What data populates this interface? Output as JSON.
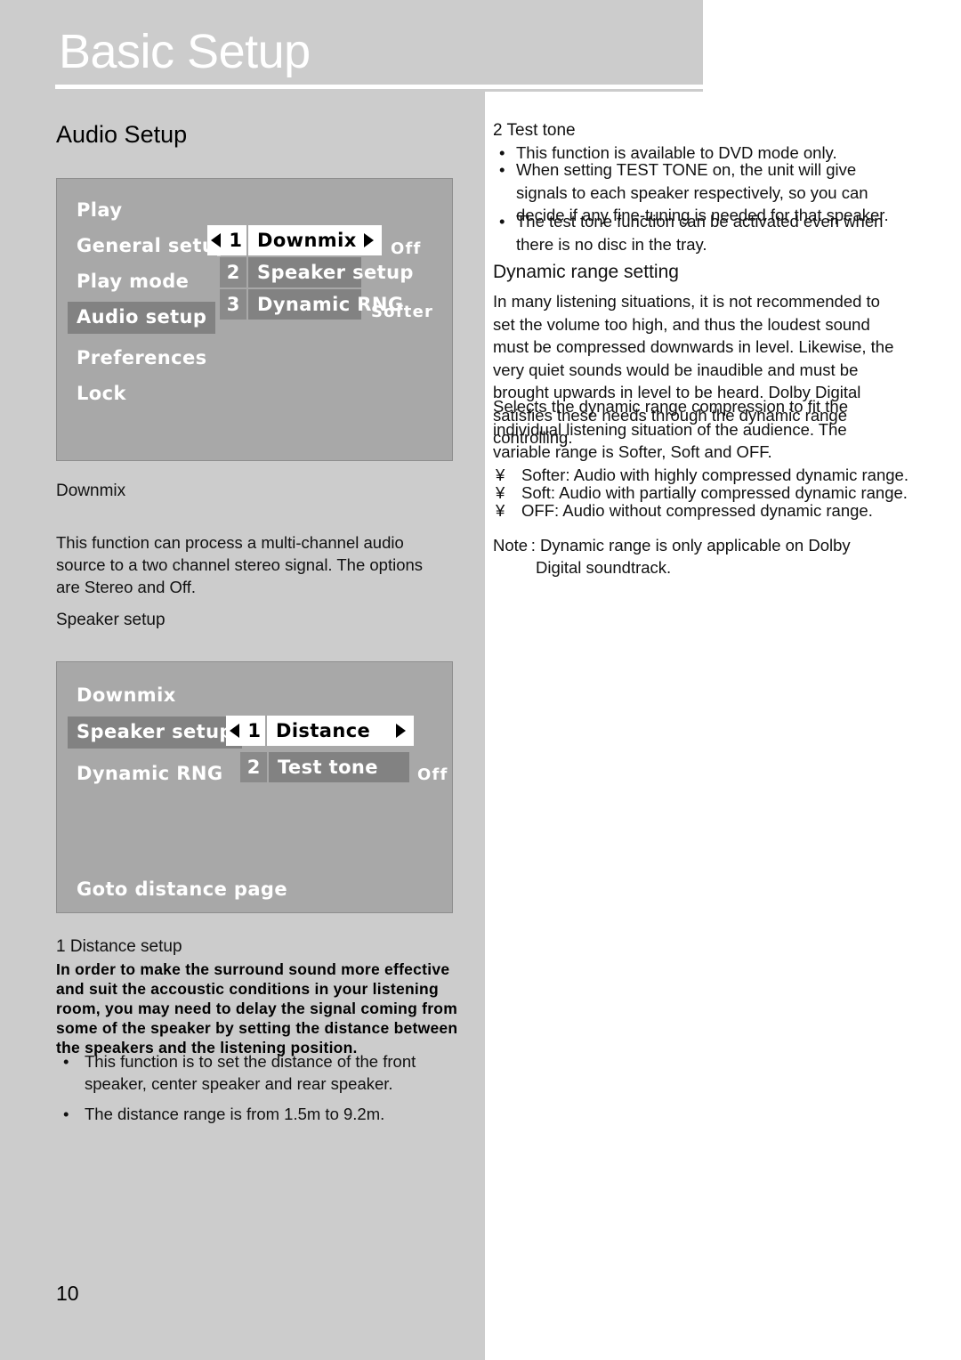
{
  "header": {
    "title": "Basic Setup"
  },
  "left": {
    "section_heading": "Audio Setup",
    "labels": {
      "downmix": "Downmix",
      "speaker_setup": "Speaker setup",
      "distance_setup": "1 Distance setup"
    },
    "downmix_paragraph": "This function can process a multi-channel audio source to a two channel stereo signal. The options are Stereo and Off.",
    "distance_bold_paragraph": "In order to make the surround sound more effective and suit the accoustic conditions in your listening room, you may need to delay the signal coming from some of the speaker by setting the distance between the speakers and the listening position.",
    "bullets": [
      {
        "dot": "•",
        "text": "This function is  to set the distance of the front speaker, center speaker and rear speaker."
      },
      {
        "dot": "•",
        "text": "The distance range is from 1.5m  to 9.2m."
      }
    ],
    "page_number": "10"
  },
  "osd_menu_1": {
    "left_items": [
      {
        "label": "Play",
        "selected": false
      },
      {
        "label": "General setup",
        "selected": false
      },
      {
        "label": "Play mode",
        "selected": false
      },
      {
        "label": "Audio setup",
        "selected": true
      },
      {
        "label": "Preferences",
        "selected": false
      },
      {
        "label": "Lock",
        "selected": false
      }
    ],
    "options": [
      {
        "number": "1",
        "label": "Downmix",
        "value": "Off",
        "active": true
      },
      {
        "number": "2",
        "label": "Speaker setup",
        "value": "",
        "active": false
      },
      {
        "number": "3",
        "label": "Dynamic RNG",
        "value": "Softer",
        "active": false
      }
    ],
    "left_arrow_icon": "triangle-left-icon",
    "right_arrow_icon": "triangle-right-icon"
  },
  "osd_menu_2": {
    "left_items": [
      {
        "label": "Downmix",
        "selected": false
      },
      {
        "label": "Speaker setup",
        "selected": true
      },
      {
        "label": "Dynamic RNG",
        "selected": false
      }
    ],
    "options": [
      {
        "number": "1",
        "label": "Distance",
        "value": "",
        "active": true
      },
      {
        "number": "2",
        "label": "Test tone",
        "value": "Off",
        "active": false
      }
    ],
    "footer": "Goto distance page"
  },
  "right": {
    "test_tone_heading": "2 Test tone",
    "test_tone_bullets": [
      {
        "dot": "•",
        "text": "This function is available to DVD mode only."
      },
      {
        "dot": "•",
        "text": "When setting TEST TONE on, the unit will give signals to each speaker respectively, so you can decide if any fine-tuning is needed for that speaker."
      },
      {
        "dot": "•",
        "text": "The test tone function can be activated even when there is no disc in the tray."
      }
    ],
    "dynamic_range_heading": "Dynamic range setting",
    "dynamic_range_paragraph_1": "In many listening situations, it is not recommended to set the volume too high, and thus the loudest sound must be compressed downwards in level. Likewise, the very quiet sounds would be inaudible and must be brought upwards in level to be heard. Dolby Digital satisfies these needs through the dynamic range controlling.",
    "dynamic_range_paragraph_2": "Selects the dynamic range compression to fit the individual listening situation of the audience. The variable range is Softer, Soft and OFF.",
    "range_items": [
      {
        "dot": "¥",
        "text": "Softer:  Audio with highly compressed dynamic range."
      },
      {
        "dot": "¥",
        "text": "Soft: Audio with partially compressed dynamic range."
      },
      {
        "dot": "¥",
        "text": "OFF: Audio without compressed dynamic range."
      }
    ],
    "note_line_1": "Note : Dynamic range is only applicable on Dolby",
    "note_line_2": "Digital soundtrack."
  },
  "colors": {
    "page_gray": "#cccccc",
    "osd_bg": "#a8a8a8",
    "osd_selected": "#828282",
    "osd_active": "#ffffff"
  }
}
